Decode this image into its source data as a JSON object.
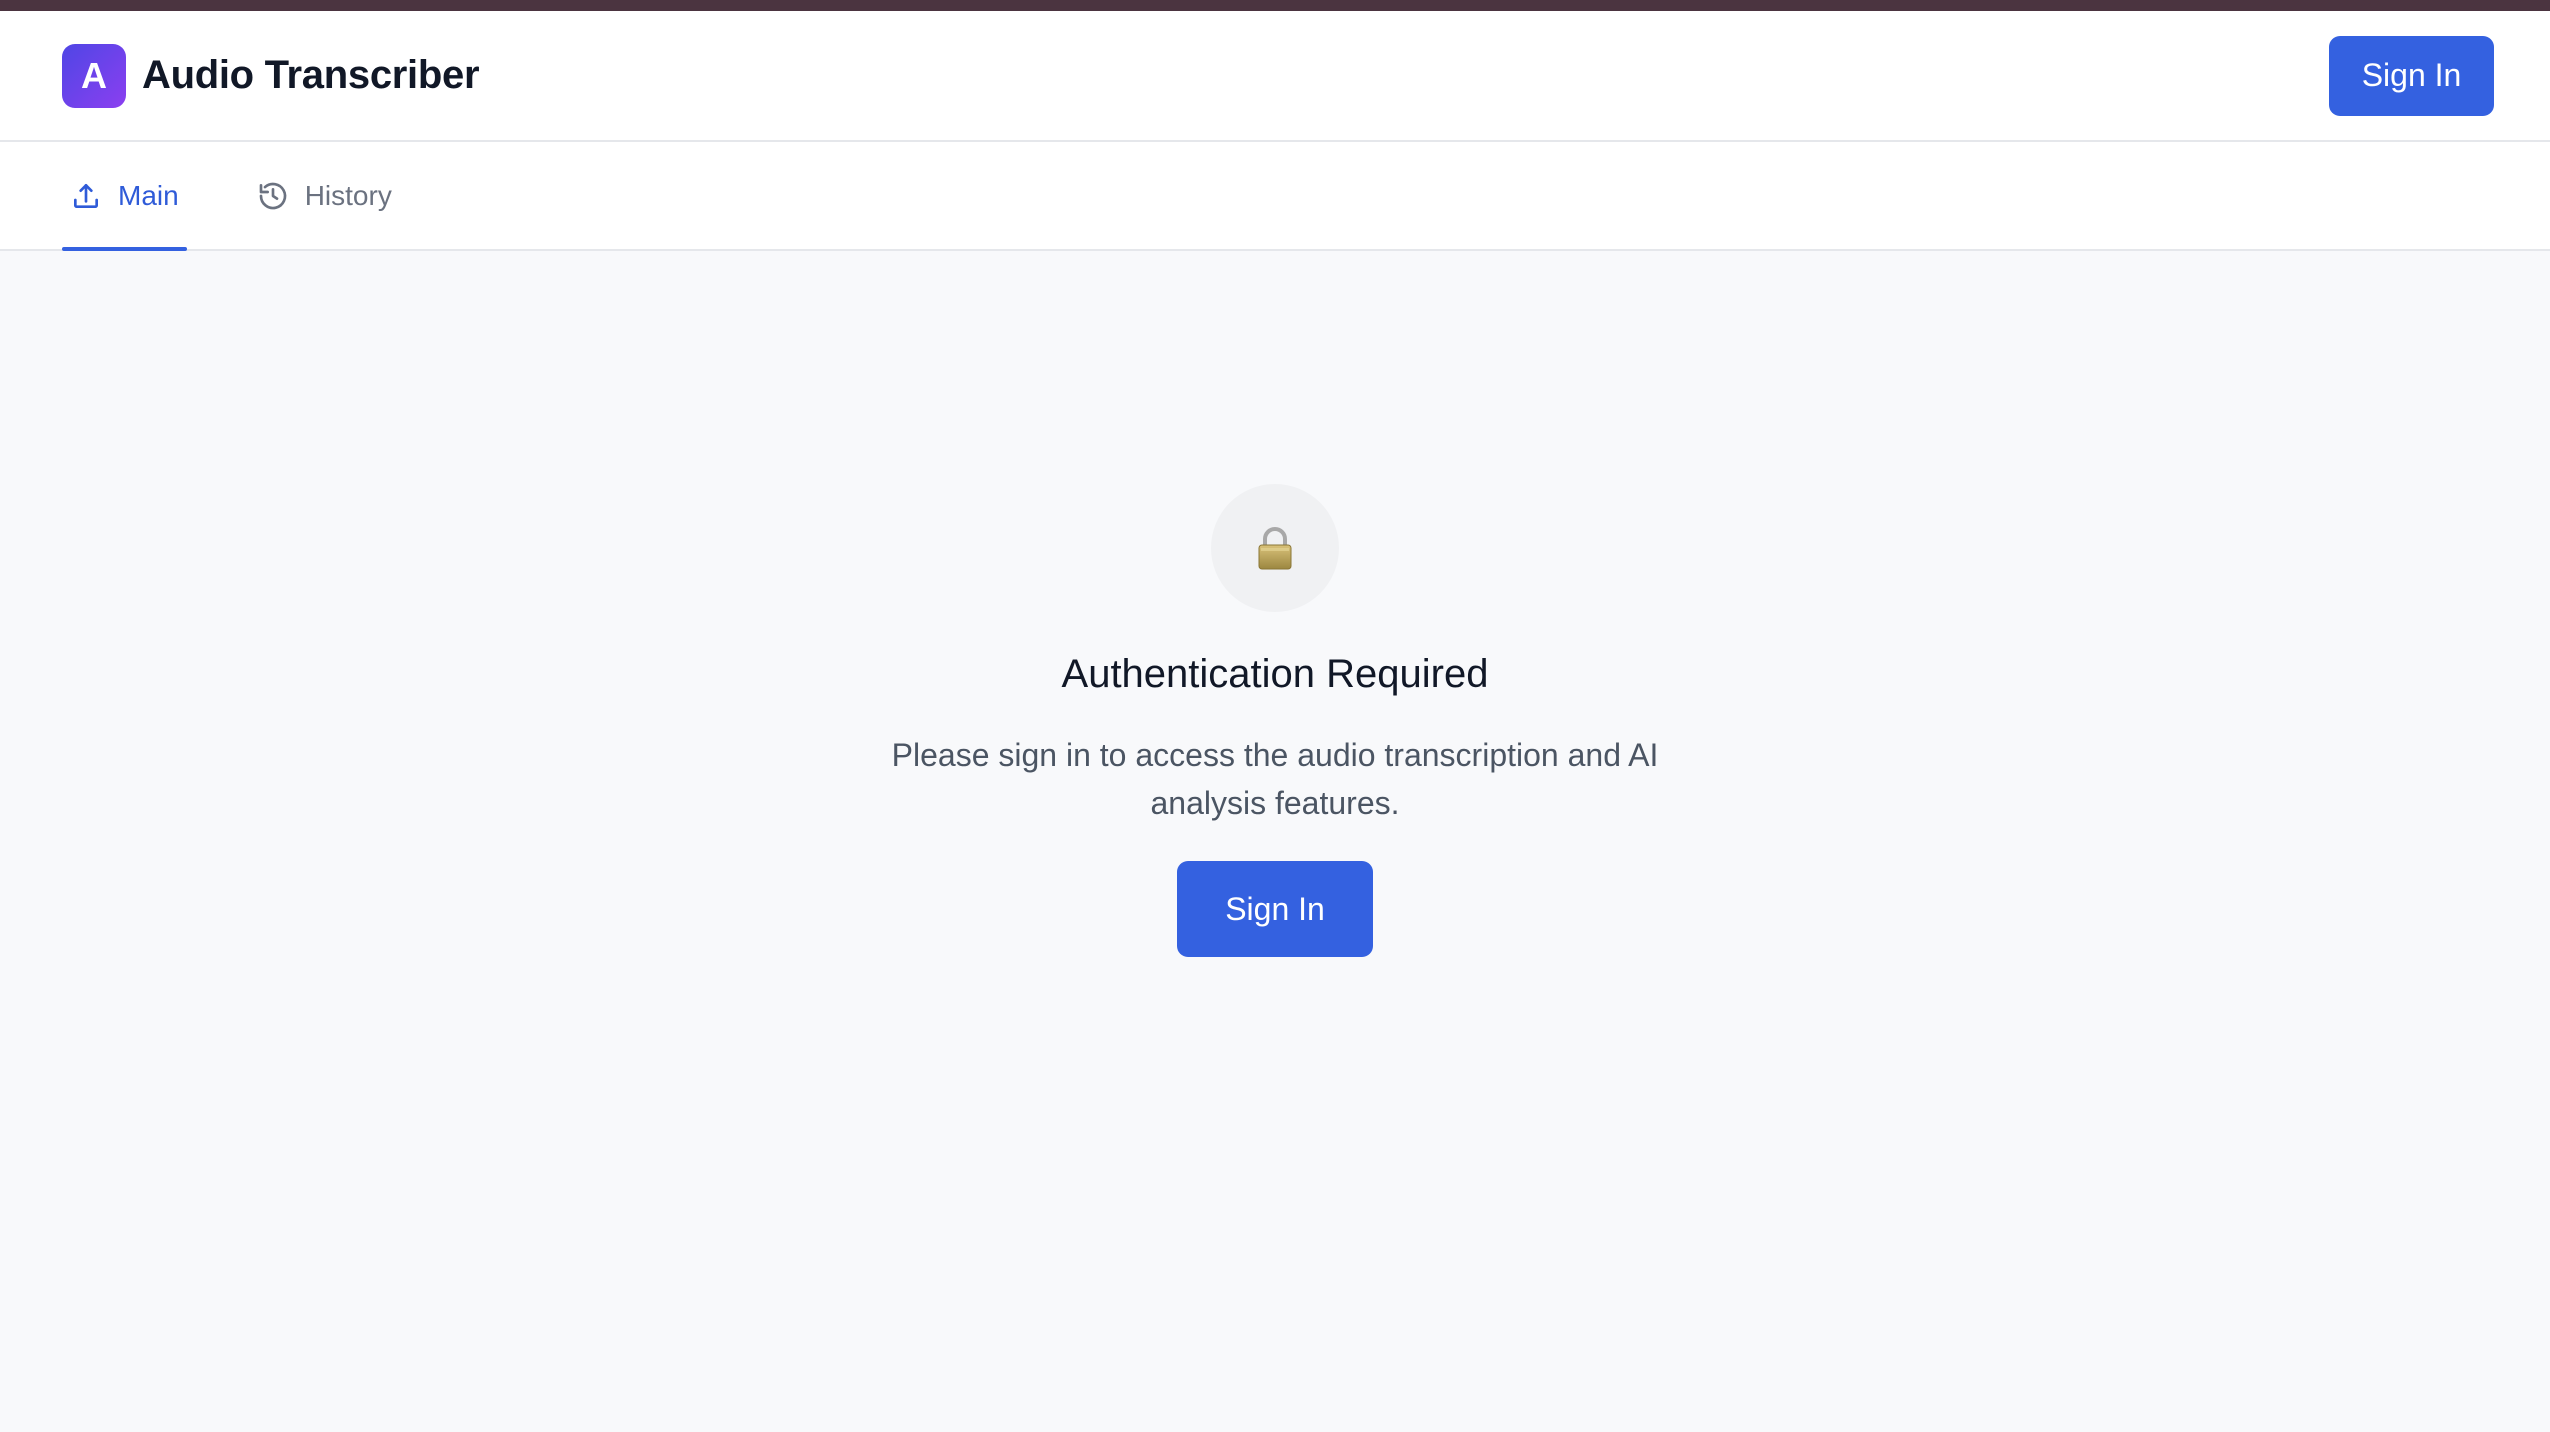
{
  "header": {
    "logo_letter": "A",
    "app_title": "Audio Transcriber",
    "sign_in_label": "Sign In"
  },
  "tabs": [
    {
      "label": "Main",
      "icon": "upload-icon",
      "active": true
    },
    {
      "label": "History",
      "icon": "history-icon",
      "active": false
    }
  ],
  "auth": {
    "icon": "lock-icon",
    "title": "Authentication Required",
    "description": "Please sign in to access the audio transcription and AI analysis features.",
    "sign_in_label": "Sign In"
  },
  "colors": {
    "accent": "#3461e0",
    "logo_gradient_start": "#4f46e5",
    "logo_gradient_end": "#8b3ff0",
    "top_strip": "#4b3440"
  }
}
